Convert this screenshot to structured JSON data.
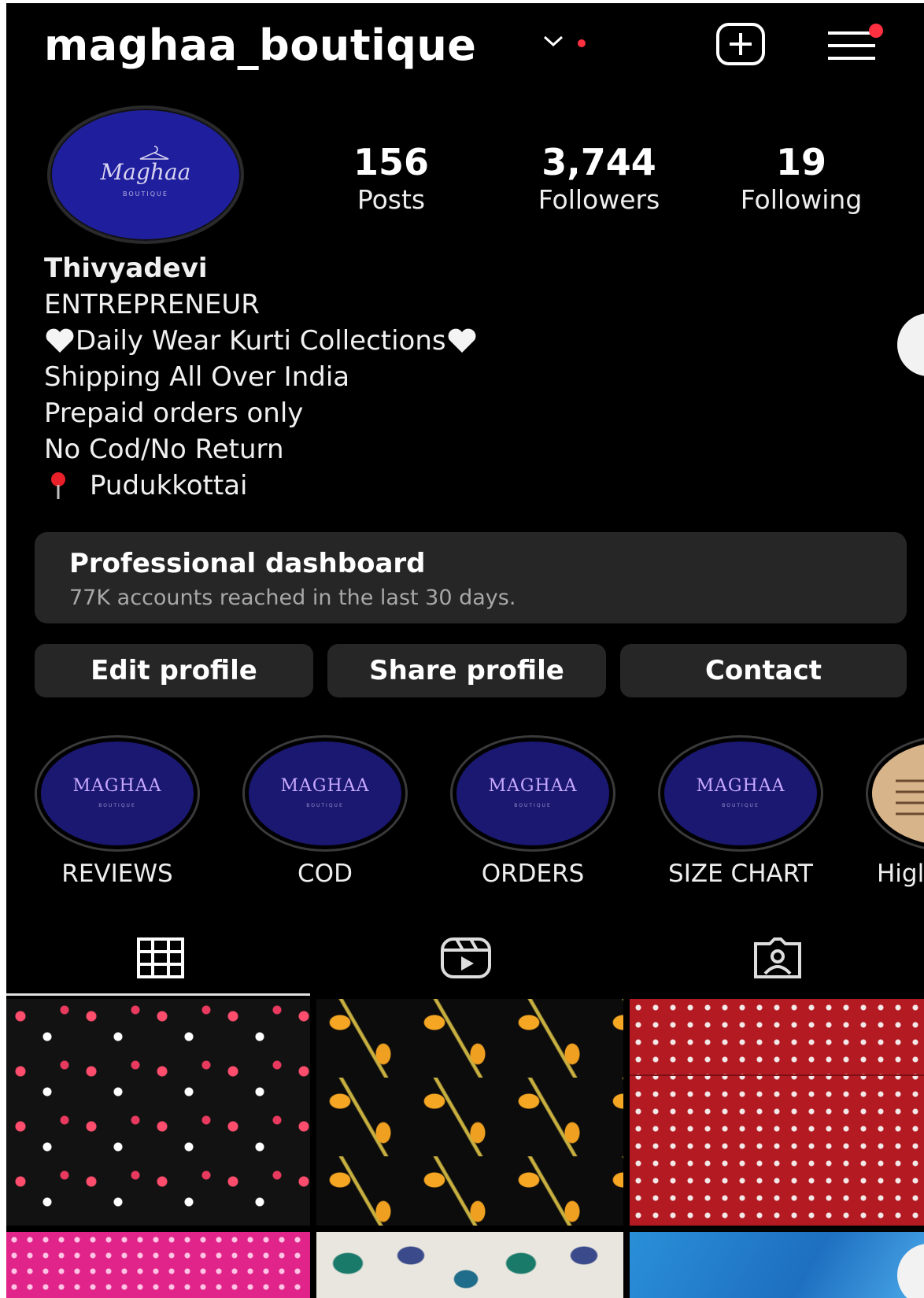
{
  "header": {
    "username": "maghaa_boutique"
  },
  "avatar": {
    "brand_script": "Maghaa",
    "brand_sub": "BOUTIQUE"
  },
  "stats": {
    "posts": {
      "value": "156",
      "label": "Posts"
    },
    "followers": {
      "value": "3,744",
      "label": "Followers"
    },
    "following": {
      "value": "19",
      "label": "Following"
    }
  },
  "bio": {
    "name": "Thivyadevi",
    "category": "ENTREPRENEUR",
    "line1": "Daily Wear Kurti Collections",
    "line2": "Shipping All Over India",
    "line3": "Prepaid orders only",
    "line4": "No Cod/No Return",
    "location": "Pudukkottai"
  },
  "dashboard": {
    "title": "Professional dashboard",
    "subtitle": "77K accounts reached in the last 30 days."
  },
  "actions": {
    "edit": "Edit profile",
    "share": "Share profile",
    "contact": "Contact"
  },
  "highlights": [
    {
      "brand": "MAGHAA",
      "brand_sub": "BOUTIQUE",
      "label": "REVIEWS"
    },
    {
      "brand": "MAGHAA",
      "brand_sub": "BOUTIQUE",
      "label": "COD"
    },
    {
      "brand": "MAGHAA",
      "brand_sub": "BOUTIQUE",
      "label": "ORDERS"
    },
    {
      "brand": "MAGHAA",
      "brand_sub": "BOUTIQUE",
      "label": "SIZE CHART"
    },
    {
      "label": "Higl"
    }
  ],
  "tabs": [
    "grid-icon",
    "reels-icon",
    "tagged-icon"
  ],
  "colors": {
    "background": "#000000",
    "surface": "#262626",
    "notification": "#ff3040",
    "avatar_blue": "#1f1f9e"
  }
}
